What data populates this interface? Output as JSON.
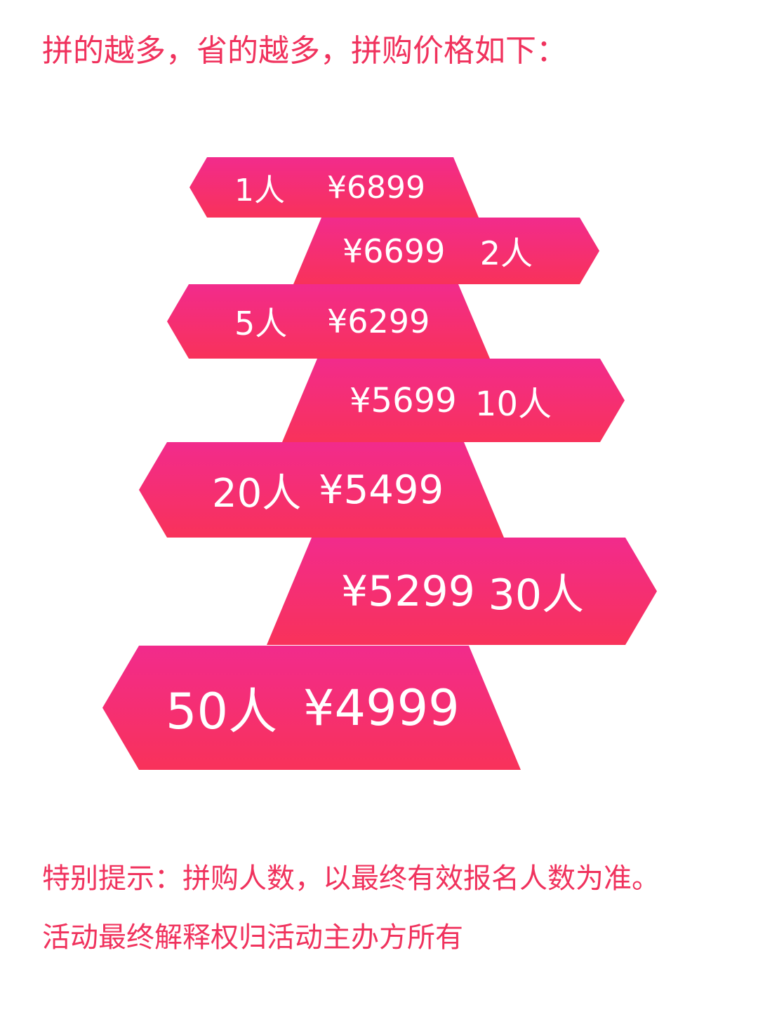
{
  "headline": "拼的越多，省的越多，拼购价格如下：",
  "colors": {
    "accent_text": "#f0325d",
    "tier_gradient_top": "#f22b8c",
    "tier_gradient_bottom": "#f8325a"
  },
  "tiers": [
    {
      "people": "1人",
      "price": "¥6899"
    },
    {
      "people": "2人",
      "price": "¥6699"
    },
    {
      "people": "5人",
      "price": "¥6299"
    },
    {
      "people": "10人",
      "price": "¥5699"
    },
    {
      "people": "20人",
      "price": "¥5499"
    },
    {
      "people": "30人",
      "price": "¥5299"
    },
    {
      "people": "50人",
      "price": "¥4999"
    }
  ],
  "notes": {
    "tip": "特别提示：拼购人数，以最终有效报名人数为准。",
    "rights": "活动最终解释权归活动主办方所有"
  }
}
